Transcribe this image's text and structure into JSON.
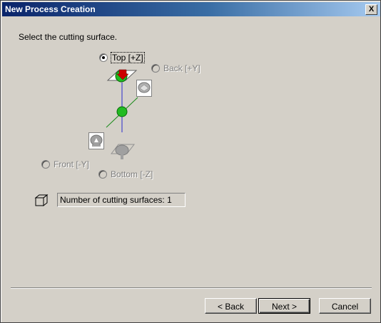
{
  "window": {
    "title": "New Process Creation",
    "close_label": "X"
  },
  "instruction": "Select the cutting surface.",
  "options": {
    "top": {
      "label": "Top [+Z]",
      "checked": true,
      "enabled": true
    },
    "back": {
      "label": "Back [+Y]",
      "checked": false,
      "enabled": false
    },
    "front": {
      "label": "Front [-Y]",
      "checked": false,
      "enabled": false
    },
    "bottom": {
      "label": "Bottom [-Z]",
      "checked": false,
      "enabled": false
    }
  },
  "surface_count": {
    "text": "Number of cutting surfaces: 1"
  },
  "buttons": {
    "back": "< Back",
    "next": "Next >",
    "cancel": "Cancel"
  },
  "colors": {
    "sphere": "#22bb22",
    "arrow": "#cc0000",
    "axis_green": "#1a8a1a",
    "axis_blue": "#2a2acc"
  }
}
